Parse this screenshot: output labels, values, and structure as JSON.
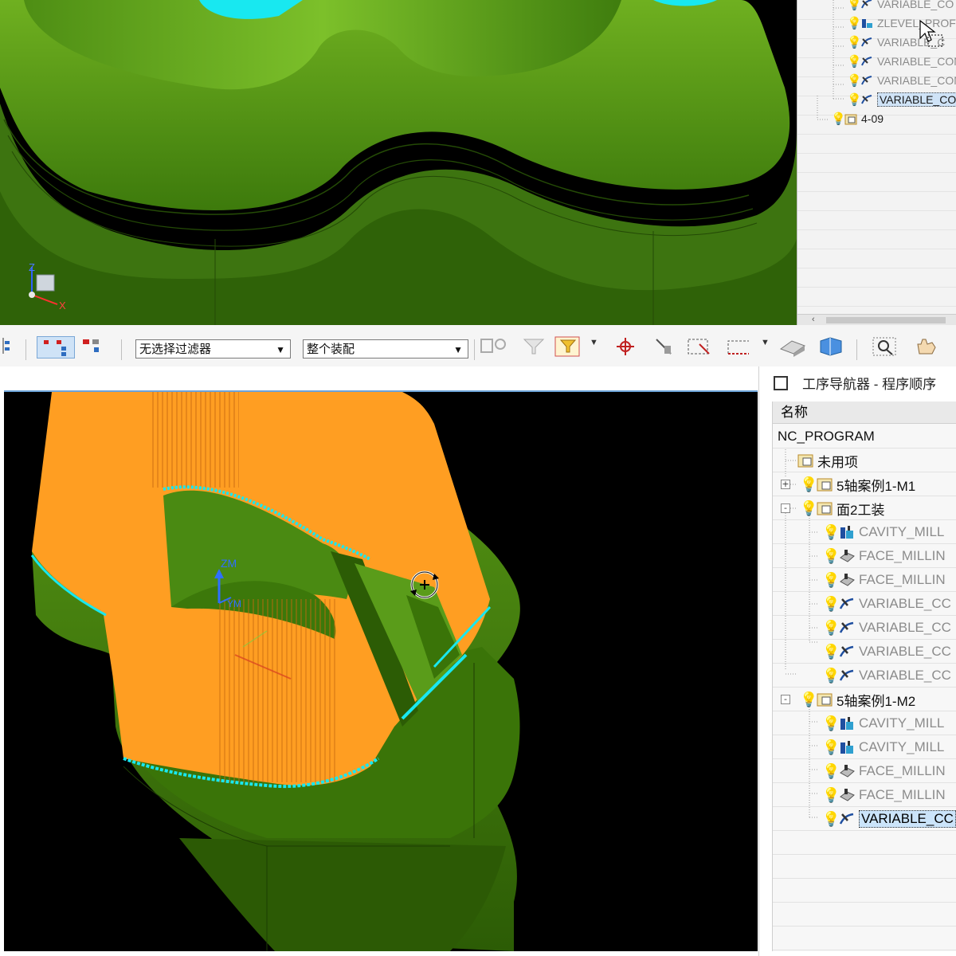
{
  "top_panel": {
    "triad_labels": {
      "z": "Z",
      "x": "X"
    },
    "navigator_items": [
      {
        "label": "VARIABLE_CO",
        "icon": "variable-contour-icon",
        "state": "normal"
      },
      {
        "label": "ZLEVEL_PROFI",
        "icon": "zlevel-profile-icon",
        "state": "normal"
      },
      {
        "label": "VARIABLE_C",
        "icon": "variable-contour-icon",
        "state": "drag"
      },
      {
        "label": "VARIABLE_CON",
        "icon": "variable-contour-icon",
        "state": "normal"
      },
      {
        "label": "VARIABLE_CON",
        "icon": "variable-contour-icon",
        "state": "normal"
      },
      {
        "label": "VARIABLE_CON",
        "icon": "variable-contour-icon",
        "state": "selected"
      },
      {
        "label": "4-09",
        "icon": "program-group-icon",
        "state": "group"
      }
    ]
  },
  "toolbar": {
    "filter_value": "无选择过滤器",
    "scope_value": "整个装配"
  },
  "viewport": {
    "wcs_labels": {
      "zm": "ZM",
      "ym": "YM"
    }
  },
  "navigator": {
    "title": "工序导航器 - 程序顺序",
    "column_name": "名称",
    "root": "NC_PROGRAM",
    "items": [
      {
        "label": "未用项",
        "type": "group",
        "level": 1
      },
      {
        "label": "5轴案例1-M1",
        "type": "group",
        "level": 1,
        "expander": "+"
      },
      {
        "label": "面2工装",
        "type": "group",
        "level": 1,
        "expander": "-"
      },
      {
        "label": "CAVITY_MILL",
        "type": "cavity",
        "level": 2
      },
      {
        "label": "FACE_MILLIN",
        "type": "face",
        "level": 2
      },
      {
        "label": "FACE_MILLIN",
        "type": "face",
        "level": 2
      },
      {
        "label": "VARIABLE_CC",
        "type": "variable",
        "level": 2
      },
      {
        "label": "VARIABLE_CC",
        "type": "variable",
        "level": 2
      },
      {
        "label": "VARIABLE_CC",
        "type": "variable",
        "level": 2
      },
      {
        "label": "VARIABLE_CC",
        "type": "variable",
        "level": 2
      },
      {
        "label": "5轴案例1-M2",
        "type": "group",
        "level": 1,
        "expander": "-"
      },
      {
        "label": "CAVITY_MILL",
        "type": "cavity",
        "level": 2
      },
      {
        "label": "CAVITY_MILL",
        "type": "cavity",
        "level": 2
      },
      {
        "label": "FACE_MILLIN",
        "type": "face",
        "level": 2
      },
      {
        "label": "FACE_MILLIN",
        "type": "face",
        "level": 2
      },
      {
        "label": "VARIABLE_CC",
        "type": "variable",
        "level": 2,
        "selected": true
      }
    ]
  },
  "colors": {
    "part_green": "#5a9c1a",
    "toolpath_orange": "#ff9e22",
    "cut_cyan": "#18e8f0",
    "bulb_yellow": "#e8b800",
    "selection_blue": "#cbe4fa"
  }
}
